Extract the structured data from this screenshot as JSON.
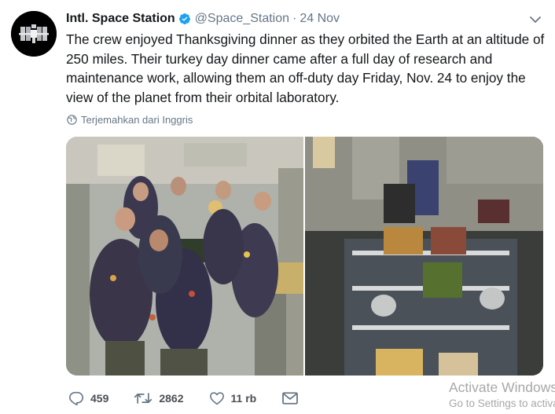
{
  "account": {
    "display_name": "Intl. Space Station",
    "handle": "@Space_Station",
    "separator": "·",
    "date": "24 Nov",
    "avatar_icon": "iss-station-icon",
    "verified_icon": "verified-badge-icon",
    "verified_color": "#1da1f2"
  },
  "tweet": {
    "text_lines": [
      "The crew enjoyed Thanksgiving dinner as they orbited the Earth at an altitude of",
      "250 miles. Their turkey day dinner came after a full day of research and",
      "maintenance work, allowing them an off-duty day Friday, Nov. 24 to enjoy the",
      "view of the planet from their orbital laboratory."
    ]
  },
  "translate": {
    "label": "Terjemahkan dari Inggris",
    "icon": "globe-icon"
  },
  "media": {
    "photos": [
      {
        "name": "crew-group-photo"
      },
      {
        "name": "thanksgiving-food-table-photo"
      }
    ]
  },
  "actions": {
    "reply": {
      "icon": "reply-icon",
      "count": "459"
    },
    "retweet": {
      "icon": "retweet-icon",
      "count": "2862"
    },
    "like": {
      "icon": "heart-icon",
      "count": "11 rb"
    },
    "message": {
      "icon": "envelope-icon"
    }
  },
  "watermark": {
    "title": "Activate Windows",
    "subtitle": "Go to Settings to activate Windows."
  },
  "colors": {
    "text": "#14171a",
    "secondary": "#657786",
    "verified": "#1da1f2",
    "watermark": "#a8a8a8"
  }
}
